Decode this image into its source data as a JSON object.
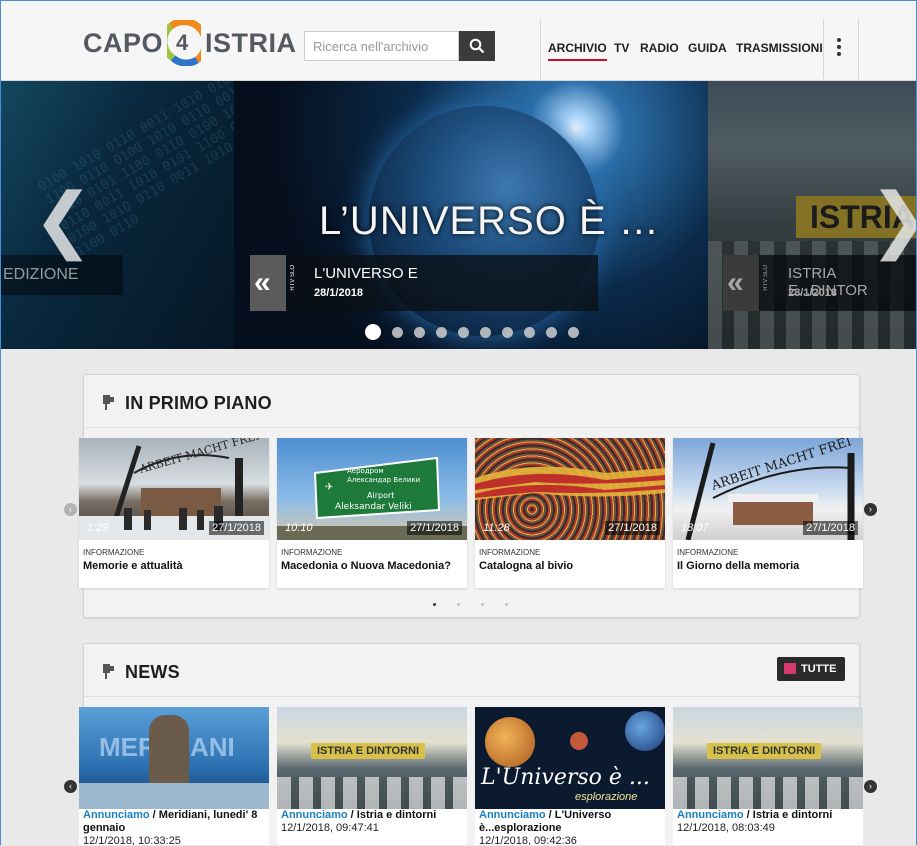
{
  "header": {
    "logo": {
      "left": "CAPO",
      "right": "ISTRIA"
    },
    "search": {
      "placeholder": "Ricerca nell'archivio"
    },
    "nav": [
      "ARCHIVIO",
      "TV",
      "RADIO",
      "GUIDA",
      "TRASMISSIONI"
    ]
  },
  "hero": {
    "left_caption": "EDIZIONE",
    "main_title": "L’UNIVERSO È …",
    "right_sign": "ISTRIA",
    "slides": [
      {
        "title": "L'UNIVERSO E",
        "date": "28/1/2018"
      },
      {
        "title": "ISTRIA E...DINTOR",
        "date": "28/1/2018"
      }
    ],
    "logo_mark": "RTV SLO",
    "dot_count": 10,
    "active_dot": 0
  },
  "in_primo_piano": {
    "title": "IN PRIMO PIANO",
    "items": [
      {
        "duration": "1:29",
        "date": "27/1/2018",
        "category": "INFORMAZIONE",
        "title": "Memorie e attualità",
        "gate_text": "ARBEIT MACHT FREI"
      },
      {
        "duration": "10:10",
        "date": "27/1/2018",
        "category": "INFORMAZIONE",
        "title": "Macedonia o Nuova Macedonia?",
        "sign_lines": [
          "Аеродром",
          "Александар Велики",
          "Airport",
          "Aleksandar Veliki"
        ]
      },
      {
        "duration": "11:28",
        "date": "27/1/2018",
        "category": "INFORMAZIONE",
        "title": "Catalogna al bivio"
      },
      {
        "duration": "18:07",
        "date": "27/1/2018",
        "category": "INFORMAZIONE",
        "title": "Il Giorno della memoria",
        "gate_text": "ARBEIT MACHT FREI"
      }
    ],
    "page_dots": 4,
    "active_page": 0
  },
  "news": {
    "title": "NEWS",
    "all_label": "TUTTE",
    "items": [
      {
        "link": "Annunciamo",
        "sep": " / ",
        "title": "Meridiani, lunedi' 8 gennaio",
        "time": "12/1/2018, 10:33:25",
        "thumb_text": "MERIDIANI"
      },
      {
        "link": "Annunciamo",
        "sep": " / ",
        "title": "Istria e dintorni",
        "time": "12/1/2018, 09:47:41",
        "thumb_text": "ISTRIA E DINTORNI"
      },
      {
        "link": "Annunciamo",
        "sep": " / ",
        "title": "L'Universo è...esplorazione",
        "time": "12/1/2018, 09:42:36",
        "thumb_text": "L'Universo è ...",
        "thumb_sub": "esplorazione"
      },
      {
        "link": "Annunciamo",
        "sep": " / ",
        "title": "Istria e dintorni",
        "time": "12/1/2018, 08:03:49",
        "thumb_text": "ISTRIA E DINTORNI"
      }
    ]
  },
  "colors": {
    "accent": "#c8102e",
    "link": "#1b7fbf",
    "tutte_icon": "#d33b6e"
  }
}
